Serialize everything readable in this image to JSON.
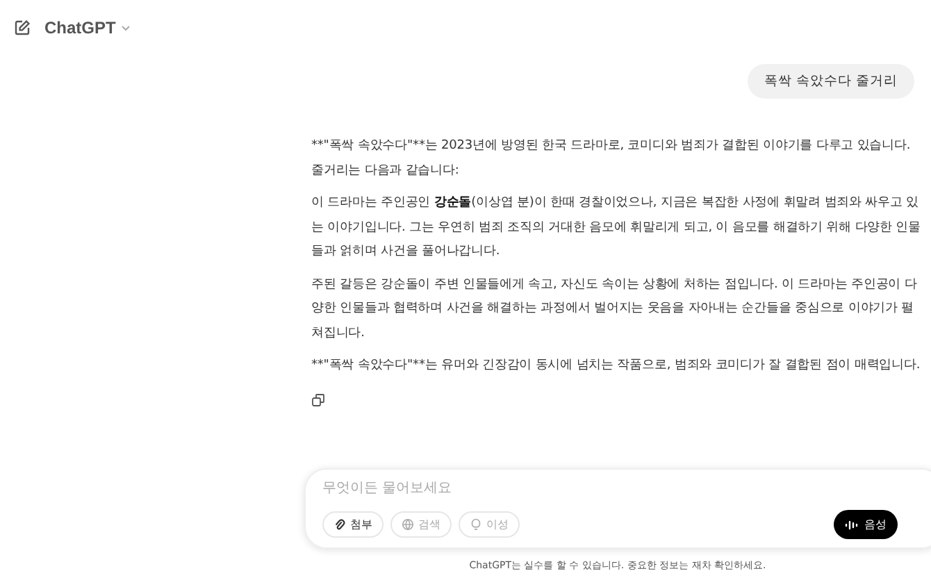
{
  "header": {
    "title": "ChatGPT"
  },
  "user_message": "폭싹 속았수다 줄거리",
  "response": {
    "paragraphs": [
      {
        "kind": "plain",
        "text": "**\"폭싹 속았수다\"**는 2023년에 방영된 한국 드라마로, 코미디와 범죄가 결합된 이야기를 다루고 있습니다. 줄거리는 다음과 같습니다:"
      },
      {
        "kind": "rich",
        "text": "이 드라마는 주인공인 **강순돌**(이상엽 분)이 한때 경찰이었으나, 지금은 복잡한 사정에 휘말려 범죄와 싸우고 있는 이야기입니다. 그는 우연히 범죄 조직의 거대한 음모에 휘말리게 되고, 이 음모를 해결하기 위해 다양한 인물들과 얽히며 사건을 풀어나갑니다."
      },
      {
        "kind": "plain",
        "text": "주된 갈등은 강순돌이 주변 인물들에게 속고, 자신도 속이는 상황에 처하는 점입니다. 이 드라마는 주인공이 다양한 인물들과 협력하며 사건을 해결하는 과정에서 벌어지는 웃음을 자아내는 순간들을 중심으로 이야기가 펼쳐집니다."
      },
      {
        "kind": "plain",
        "text": "**\"폭싹 속았수다\"**는 유머와 긴장감이 동시에 넘치는 작품으로, 범죄와 코미디가 잘 결합된 점이 매력입니다."
      }
    ]
  },
  "composer": {
    "placeholder": "무엇이든 물어보세요",
    "tools": [
      {
        "kind": "attach",
        "label": "첨부",
        "disabled": false
      },
      {
        "kind": "search",
        "label": "검색",
        "disabled": true
      },
      {
        "kind": "reason",
        "label": "이성",
        "disabled": true
      }
    ],
    "voice_button": "음성"
  },
  "footer": "ChatGPT는 실수를 할 수 있습니다. 중요한 정보는 재차 확인하세요."
}
